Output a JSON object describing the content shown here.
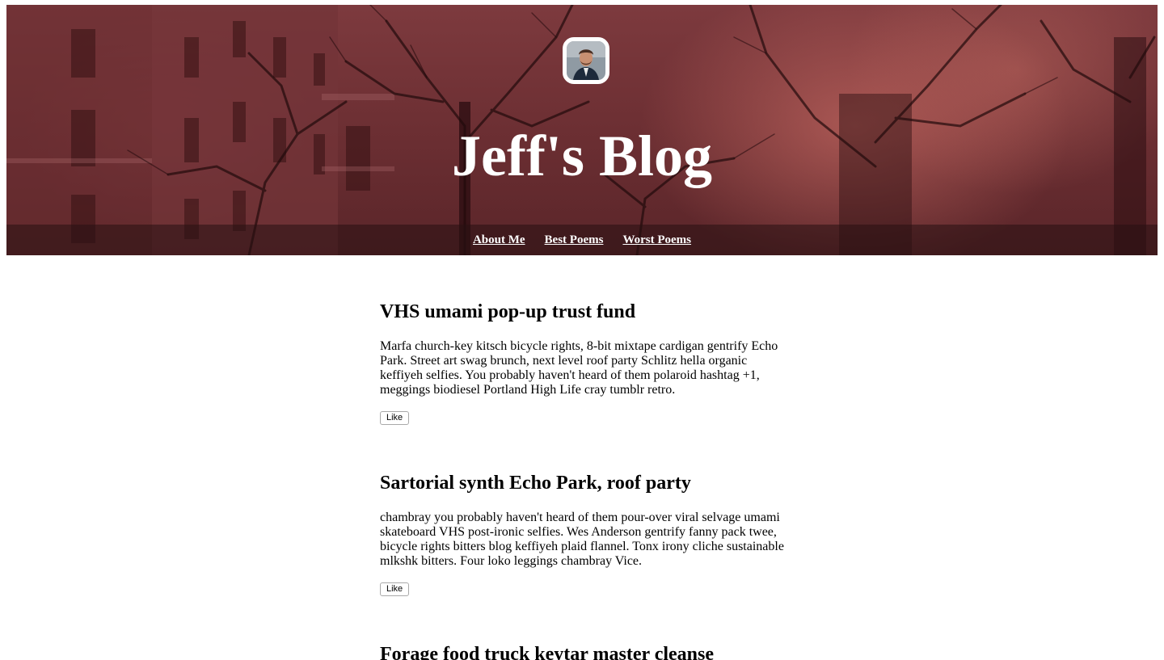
{
  "header": {
    "title": "Jeff's Blog",
    "avatar_icon": "profile-photo",
    "nav": [
      {
        "label": "About Me"
      },
      {
        "label": "Best Poems"
      },
      {
        "label": "Worst Poems"
      }
    ]
  },
  "colors": {
    "hero_tint": "#7d3a3e",
    "nav_bar": "#281012",
    "text": "#000000",
    "link": "#ffffff"
  },
  "posts": [
    {
      "title": "VHS umami pop-up trust fund",
      "body": "Marfa church-key kitsch bicycle rights, 8-bit mixtape cardigan gentrify Echo Park. Street art swag brunch, next level roof party Schlitz hella organic keffiyeh selfies. You probably haven't heard of them polaroid hashtag +1, meggings biodiesel Portland High Life cray tumblr retro.",
      "like_label": "Like"
    },
    {
      "title": "Sartorial synth Echo Park, roof party",
      "body": "chambray you probably haven't heard of them pour-over viral selvage umami skateboard VHS post-ironic selfies. Wes Anderson gentrify fanny pack twee, bicycle rights bitters blog keffiyeh plaid flannel. Tonx irony cliche sustainable mlkshk bitters. Four loko leggings chambray Vice.",
      "like_label": "Like"
    },
    {
      "title": "Forage food truck keytar master cleanse",
      "body": "",
      "like_label": ""
    }
  ]
}
